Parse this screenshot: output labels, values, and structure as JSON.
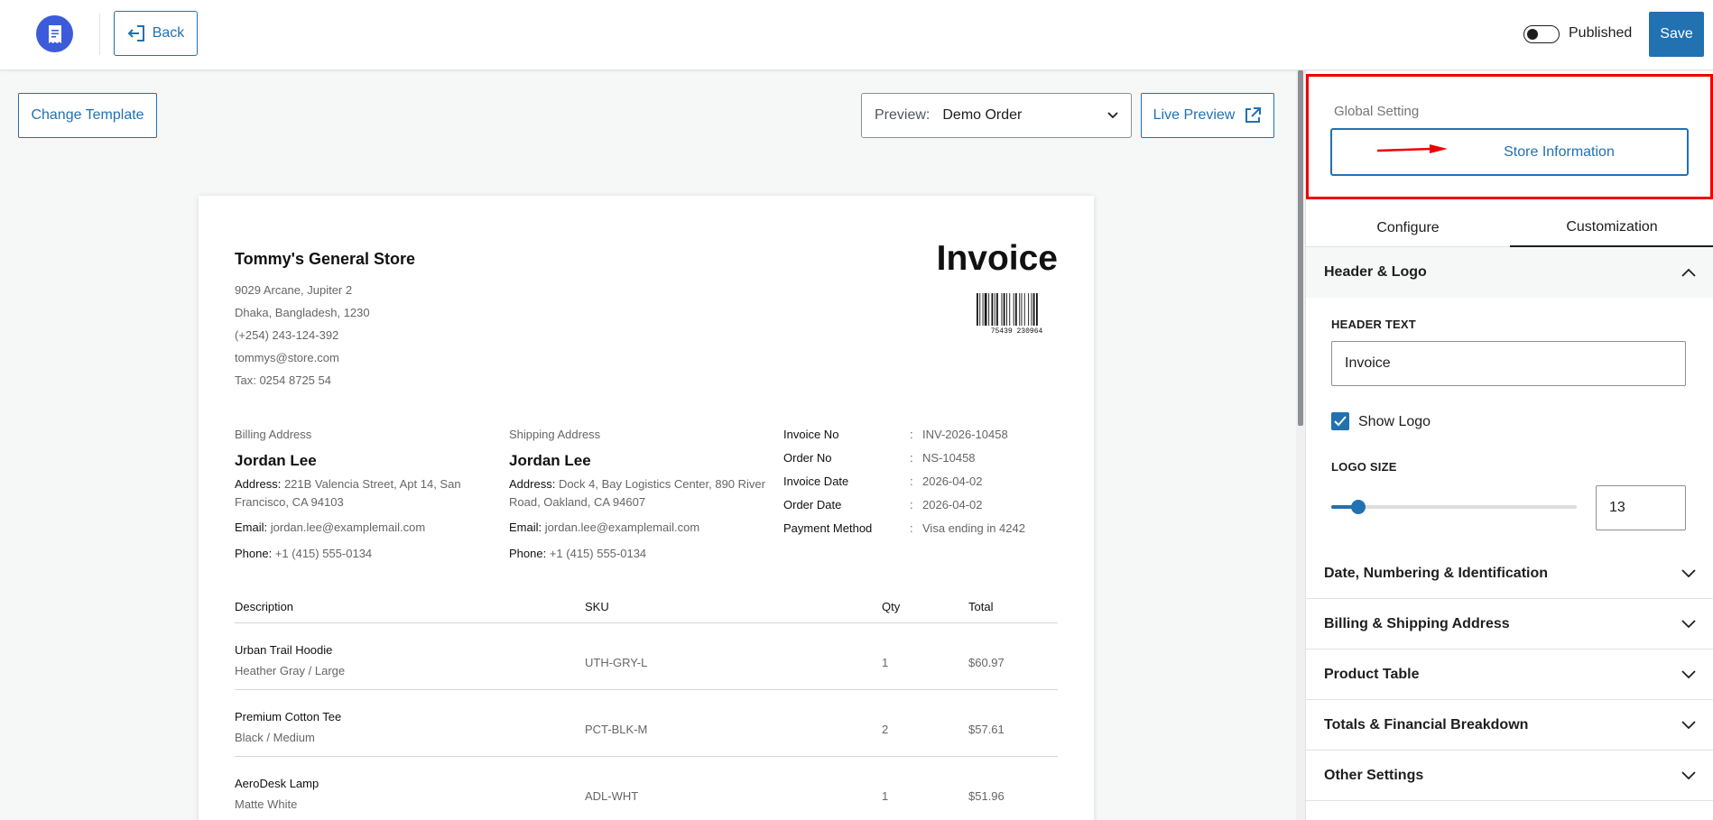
{
  "topbar": {
    "logo_icon": "receipt-icon",
    "back_label": "Back",
    "published_label": "Published",
    "published_on": false,
    "save_label": "Save"
  },
  "toolbar": {
    "change_template_label": "Change Template",
    "preview_label": "Preview:",
    "preview_value": "Demo Order",
    "live_preview_label": "Live Preview"
  },
  "invoice": {
    "store_name": "Tommy's General Store",
    "store_lines": [
      "9029 Arcane, Jupiter 2",
      "Dhaka, Bangladesh, 1230",
      "(+254) 243-124-392",
      "tommys@store.com",
      "Tax: 0254 8725 54"
    ],
    "title": "Invoice",
    "barcode_text": "75439 230964",
    "billing": {
      "label": "Billing Address",
      "name": "Jordan Lee",
      "address_key": "Address:",
      "address": "221B Valencia Street, Apt 14, San Francisco, CA 94103",
      "email_key": "Email:",
      "email": "jordan.lee@examplemail.com",
      "phone_key": "Phone:",
      "phone": "+1 (415) 555-0134"
    },
    "shipping": {
      "label": "Shipping Address",
      "name": "Jordan Lee",
      "address_key": "Address:",
      "address": "Dock 4, Bay Logistics Center, 890 River Road, Oakland, CA 94607",
      "email_key": "Email:",
      "email": "jordan.lee@examplemail.com",
      "phone_key": "Phone:",
      "phone": "+1 (415) 555-0134"
    },
    "meta": [
      {
        "k": "Invoice No",
        "v": "INV-2026-10458"
      },
      {
        "k": "Order No",
        "v": "NS-10458"
      },
      {
        "k": "Invoice Date",
        "v": "2026-04-02"
      },
      {
        "k": "Order Date",
        "v": "2026-04-02"
      },
      {
        "k": "Payment Method",
        "v": "Visa ending in 4242"
      }
    ],
    "table_headers": [
      "Description",
      "SKU",
      "Qty",
      "Total"
    ],
    "items": [
      {
        "name": "Urban Trail Hoodie",
        "variant": "Heather Gray / Large",
        "sku": "UTH-GRY-L",
        "qty": "1",
        "total": "$60.97"
      },
      {
        "name": "Premium Cotton Tee",
        "variant": "Black / Medium",
        "sku": "PCT-BLK-M",
        "qty": "2",
        "total": "$57.61"
      },
      {
        "name": "AeroDesk Lamp",
        "variant": "Matte White",
        "sku": "ADL-WHT",
        "qty": "1",
        "total": "$51.96"
      }
    ]
  },
  "panel": {
    "global_setting_label": "Global Setting",
    "store_info_label": "Store Information",
    "tabs": [
      "Configure",
      "Customization"
    ],
    "active_tab": "Customization",
    "header_logo": {
      "title": "Header & Logo",
      "header_text_label": "HEADER TEXT",
      "header_text_value": "Invoice",
      "show_logo_label": "Show Logo",
      "show_logo_checked": true,
      "logo_size_label": "LOGO SIZE",
      "logo_size_value": "13",
      "logo_size_fraction": 0.11
    },
    "sections": [
      "Date, Numbering & Identification",
      "Billing & Shipping Address",
      "Product Table",
      "Totals & Financial Breakdown",
      "Other Settings"
    ]
  },
  "colors": {
    "accent": "#2271b1",
    "logo_bg": "#3b5bdb",
    "highlight_red": "#e00000"
  }
}
